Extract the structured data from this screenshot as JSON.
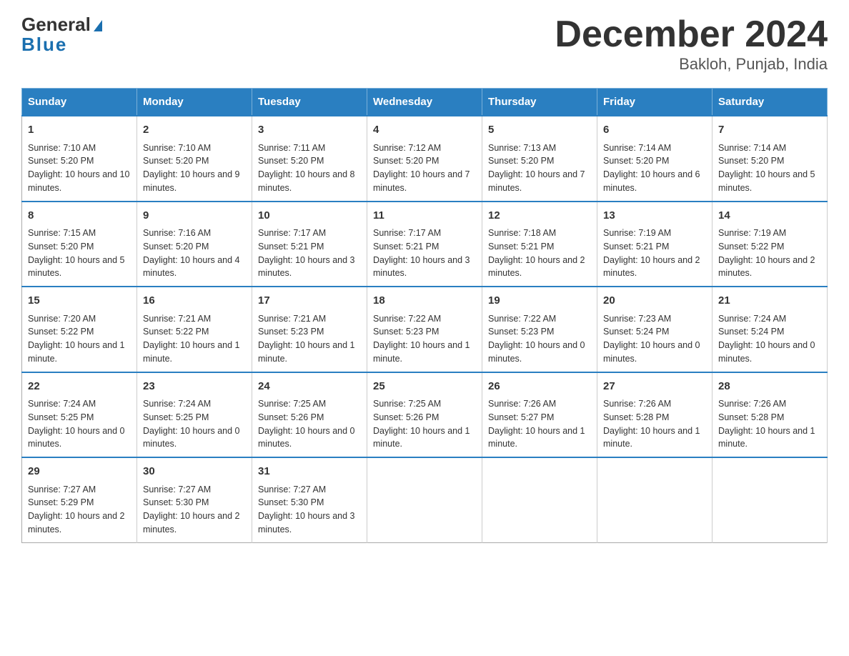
{
  "header": {
    "logo_line1": "General",
    "logo_line2": "Blue",
    "title": "December 2024",
    "subtitle": "Bakloh, Punjab, India"
  },
  "days_of_week": [
    "Sunday",
    "Monday",
    "Tuesday",
    "Wednesday",
    "Thursday",
    "Friday",
    "Saturday"
  ],
  "weeks": [
    [
      {
        "day": "1",
        "sunrise": "7:10 AM",
        "sunset": "5:20 PM",
        "daylight": "10 hours and 10 minutes."
      },
      {
        "day": "2",
        "sunrise": "7:10 AM",
        "sunset": "5:20 PM",
        "daylight": "10 hours and 9 minutes."
      },
      {
        "day": "3",
        "sunrise": "7:11 AM",
        "sunset": "5:20 PM",
        "daylight": "10 hours and 8 minutes."
      },
      {
        "day": "4",
        "sunrise": "7:12 AM",
        "sunset": "5:20 PM",
        "daylight": "10 hours and 7 minutes."
      },
      {
        "day": "5",
        "sunrise": "7:13 AM",
        "sunset": "5:20 PM",
        "daylight": "10 hours and 7 minutes."
      },
      {
        "day": "6",
        "sunrise": "7:14 AM",
        "sunset": "5:20 PM",
        "daylight": "10 hours and 6 minutes."
      },
      {
        "day": "7",
        "sunrise": "7:14 AM",
        "sunset": "5:20 PM",
        "daylight": "10 hours and 5 minutes."
      }
    ],
    [
      {
        "day": "8",
        "sunrise": "7:15 AM",
        "sunset": "5:20 PM",
        "daylight": "10 hours and 5 minutes."
      },
      {
        "day": "9",
        "sunrise": "7:16 AM",
        "sunset": "5:20 PM",
        "daylight": "10 hours and 4 minutes."
      },
      {
        "day": "10",
        "sunrise": "7:17 AM",
        "sunset": "5:21 PM",
        "daylight": "10 hours and 3 minutes."
      },
      {
        "day": "11",
        "sunrise": "7:17 AM",
        "sunset": "5:21 PM",
        "daylight": "10 hours and 3 minutes."
      },
      {
        "day": "12",
        "sunrise": "7:18 AM",
        "sunset": "5:21 PM",
        "daylight": "10 hours and 2 minutes."
      },
      {
        "day": "13",
        "sunrise": "7:19 AM",
        "sunset": "5:21 PM",
        "daylight": "10 hours and 2 minutes."
      },
      {
        "day": "14",
        "sunrise": "7:19 AM",
        "sunset": "5:22 PM",
        "daylight": "10 hours and 2 minutes."
      }
    ],
    [
      {
        "day": "15",
        "sunrise": "7:20 AM",
        "sunset": "5:22 PM",
        "daylight": "10 hours and 1 minute."
      },
      {
        "day": "16",
        "sunrise": "7:21 AM",
        "sunset": "5:22 PM",
        "daylight": "10 hours and 1 minute."
      },
      {
        "day": "17",
        "sunrise": "7:21 AM",
        "sunset": "5:23 PM",
        "daylight": "10 hours and 1 minute."
      },
      {
        "day": "18",
        "sunrise": "7:22 AM",
        "sunset": "5:23 PM",
        "daylight": "10 hours and 1 minute."
      },
      {
        "day": "19",
        "sunrise": "7:22 AM",
        "sunset": "5:23 PM",
        "daylight": "10 hours and 0 minutes."
      },
      {
        "day": "20",
        "sunrise": "7:23 AM",
        "sunset": "5:24 PM",
        "daylight": "10 hours and 0 minutes."
      },
      {
        "day": "21",
        "sunrise": "7:24 AM",
        "sunset": "5:24 PM",
        "daylight": "10 hours and 0 minutes."
      }
    ],
    [
      {
        "day": "22",
        "sunrise": "7:24 AM",
        "sunset": "5:25 PM",
        "daylight": "10 hours and 0 minutes."
      },
      {
        "day": "23",
        "sunrise": "7:24 AM",
        "sunset": "5:25 PM",
        "daylight": "10 hours and 0 minutes."
      },
      {
        "day": "24",
        "sunrise": "7:25 AM",
        "sunset": "5:26 PM",
        "daylight": "10 hours and 0 minutes."
      },
      {
        "day": "25",
        "sunrise": "7:25 AM",
        "sunset": "5:26 PM",
        "daylight": "10 hours and 1 minute."
      },
      {
        "day": "26",
        "sunrise": "7:26 AM",
        "sunset": "5:27 PM",
        "daylight": "10 hours and 1 minute."
      },
      {
        "day": "27",
        "sunrise": "7:26 AM",
        "sunset": "5:28 PM",
        "daylight": "10 hours and 1 minute."
      },
      {
        "day": "28",
        "sunrise": "7:26 AM",
        "sunset": "5:28 PM",
        "daylight": "10 hours and 1 minute."
      }
    ],
    [
      {
        "day": "29",
        "sunrise": "7:27 AM",
        "sunset": "5:29 PM",
        "daylight": "10 hours and 2 minutes."
      },
      {
        "day": "30",
        "sunrise": "7:27 AM",
        "sunset": "5:30 PM",
        "daylight": "10 hours and 2 minutes."
      },
      {
        "day": "31",
        "sunrise": "7:27 AM",
        "sunset": "5:30 PM",
        "daylight": "10 hours and 3 minutes."
      },
      null,
      null,
      null,
      null
    ]
  ]
}
